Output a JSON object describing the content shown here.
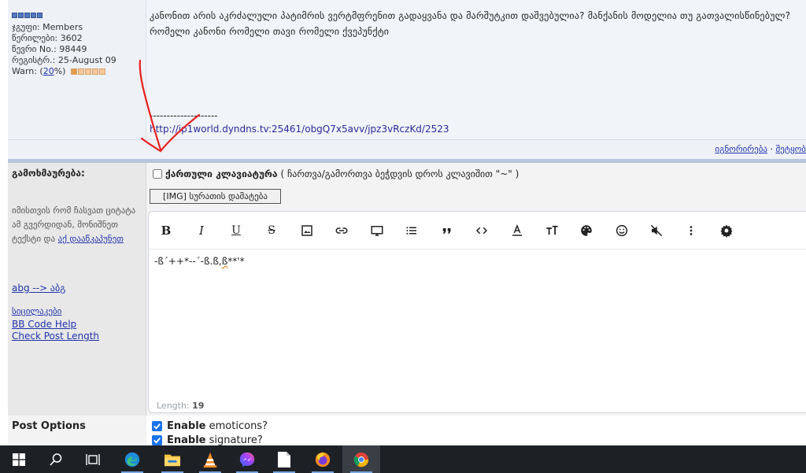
{
  "user_info": {
    "group": "ჯგუფი: Members",
    "posts": "წერილები: 3602",
    "user_no": "წევრი No.: 98449",
    "registered": "რეგისტრ.: 25-August 09",
    "warn_prefix": "Warn: (",
    "warn_value": "20",
    "warn_suffix": "%)",
    "warn_level": 0.2
  },
  "post": {
    "text": "კანონით არის აკრძალული პატიმრის ვერტმფრენით გადაყვანა და მარშუტკით დაშვებულია? მანქანის მოდელია თუ გათვალისწინებულ? რომელი კანონი რომელი თავი რომელი ქვეპუნქტი",
    "signature_separator": "--------------------",
    "signature_link": "http://ip1world.dyndns.tv:25461/obgQ7x5avv/jpz3vRczKd/2523",
    "foot_ignore": "იგნორირება",
    "foot_dot": " · ",
    "foot_quote": "შეტყობ"
  },
  "reply": {
    "title": "გამოხმაურება:",
    "hint_text": "იმისთვის რომ ჩასვათ ციტატა ამ გვერდიდან, მონიშნეთ ტექსტი და",
    "hint_link": "აქ დააწკაპუნეთ",
    "abg_link": "abg --> აბგ",
    "smilies_link": "სიცილაკები",
    "bbcode_link": "BB Code Help",
    "check_length_link": "Check Post Length",
    "georgian_keyboard_label": "ქართული კლავიატურა",
    "georgian_keyboard_hint": "( ჩართვა/გამორთვა ბეჭდვის დროს კლავიშით \"~\" )",
    "img_button": "[IMG] სურათის დამატება",
    "editor_text_a": "-ß´++*--´-ß.ß,",
    "editor_text_b": "ß",
    "editor_text_c": "**'*",
    "length_label": "Length: ",
    "length_value": "19"
  },
  "toolbar_icons": [
    "bold-icon",
    "italic-icon",
    "underline-icon",
    "strikethrough-icon",
    "image-icon",
    "link-icon",
    "monitor-icon",
    "list-icon",
    "quote-icon",
    "code-icon",
    "text-color-icon",
    "font-size-icon",
    "palette-icon",
    "emoji-icon",
    "mute-icon",
    "more-vertical-icon",
    "gear-icon"
  ],
  "post_options": {
    "title": "Post Options",
    "enable_emoticons_bold": "Enable",
    "enable_emoticons_rest": "emoticons?",
    "enable_signature_bold": "Enable",
    "enable_signature_rest": "signature?"
  },
  "taskbar": {
    "apps": [
      "windows-start",
      "search",
      "task-view",
      "edge",
      "file-explorer",
      "vlc",
      "messenger",
      "file",
      "firefox",
      "chrome"
    ]
  },
  "colors": {
    "accent_blue": "#1a73e8",
    "link": "#2233aa",
    "annotation_red": "#e8201e",
    "taskbar": "#1d2126"
  }
}
